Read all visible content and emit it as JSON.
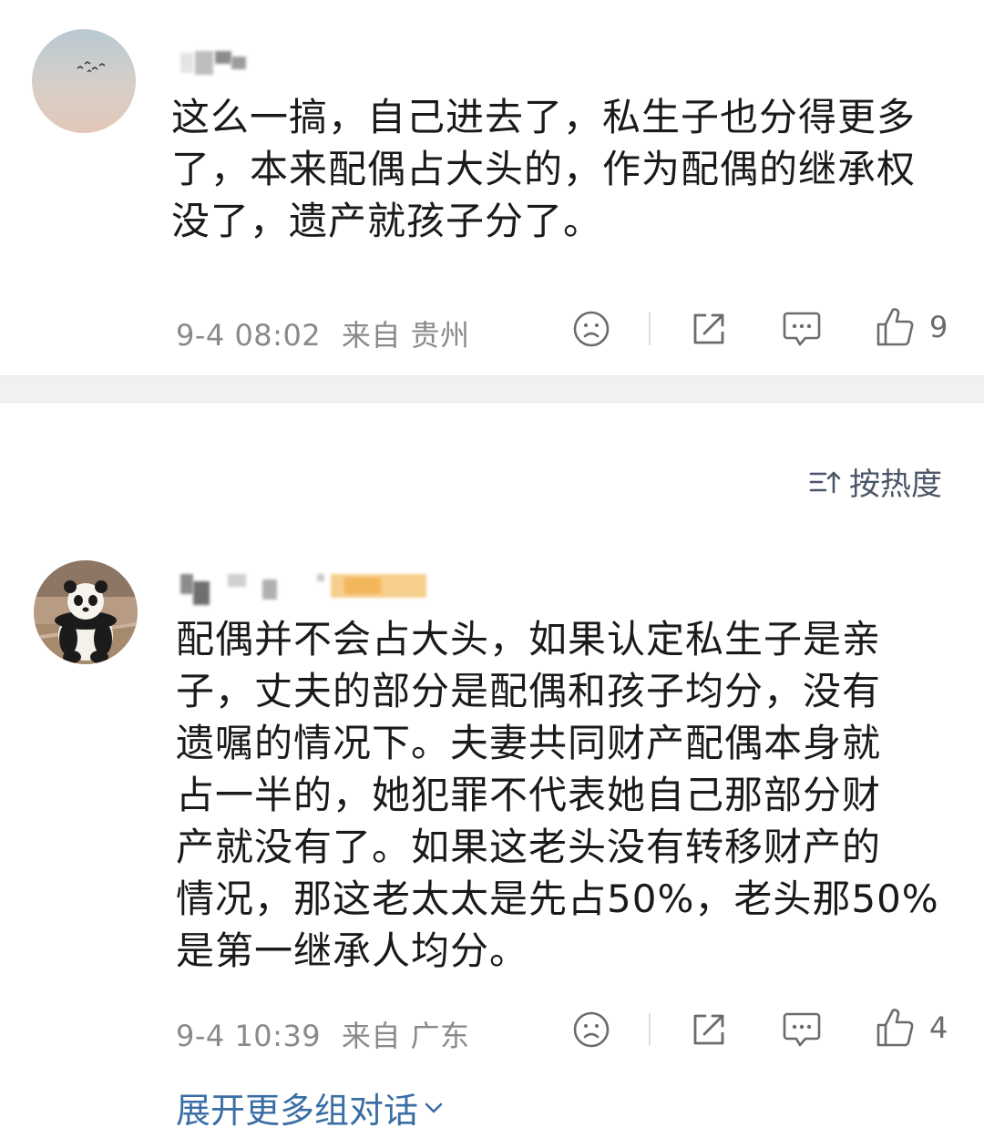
{
  "comments": [
    {
      "text": "这么一搞，自己进去了，私生子也分得更多\n了，本来配偶占大头的，作为配偶的继承权\n没了，遗产就孩子分了。",
      "time": "9-4 08:02",
      "location": "来自 贵州",
      "like_count": "9",
      "avatar_icon": "avatar-birds-sky"
    },
    {
      "text": "配偶并不会占大头，如果认定私生子是亲\n子，丈夫的部分是配偶和孩子均分，没有\n遗嘱的情况下。夫妻共同财产配偶本身就\n占一半的，她犯罪不代表她自己那部分财\n产就没有了。如果这老头没有转移财产的\n情况，那这老太太是先占50%，老头那50%\n是第一继承人均分。",
      "time": "9-4 10:39",
      "location": "来自 广东",
      "like_count": "4",
      "avatar_icon": "avatar-panda"
    }
  ],
  "sort": {
    "label": "按热度",
    "icon": "sort-icon"
  },
  "expand": {
    "label": "展开更多组对话",
    "icon": "chevron-down-icon"
  },
  "colors": {
    "link": "#3a6ea5",
    "meta": "#8a8a8a",
    "divider": "#f1f1f1"
  }
}
